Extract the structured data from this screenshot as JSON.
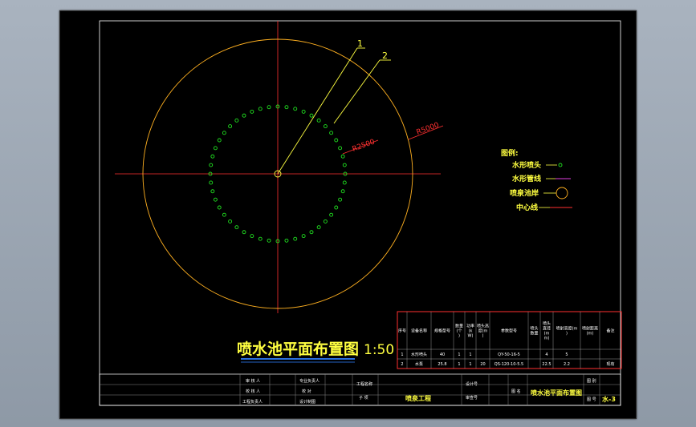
{
  "drawing": {
    "title": "喷水池平面布置图",
    "scale": "1:50",
    "colors": {
      "background": "#000000",
      "frame": "#ffffff",
      "outer_circle": "#ffb020",
      "center_line": "#ff3030",
      "nozzle_ring": "#20e020",
      "leader": "#ffff40",
      "dimension": "#ff3030",
      "table_border": "#ff3030",
      "title_text": "#ffff40"
    },
    "callouts": [
      "1",
      "2"
    ],
    "radius_labels": [
      "R2500",
      "R5000"
    ],
    "legend": {
      "heading": "图例:",
      "items": [
        {
          "label": "水形喷头",
          "symbol": "small-circle",
          "color": "#20e020"
        },
        {
          "label": "水形管线",
          "symbol": "line",
          "color": "#e040e0"
        },
        {
          "label": "喷泉池岸",
          "symbol": "circle",
          "color": "#ffb020"
        },
        {
          "label": "中心线",
          "symbol": "line",
          "color": "#ff3030"
        }
      ]
    },
    "equipment_table": {
      "headers": [
        "序号",
        "设备名称",
        "规格型号",
        "数量(个)",
        "功率(kW)",
        "喷头高度(m)",
        "参数型号",
        "喷头数量",
        "喷头直径(mm)",
        "喷射高度(m)",
        "喷射距离(m)",
        "备注"
      ],
      "rows": [
        [
          "1",
          "水形喷头",
          "40",
          "1",
          "1",
          "",
          "QY-50-16-5",
          "",
          "4",
          "5",
          "",
          ""
        ],
        [
          "2",
          "水泵",
          "25.8",
          "1",
          "1",
          "20",
          "QS-120-10-5.5",
          "",
          "22.5",
          "2.2",
          "",
          "现有"
        ]
      ]
    },
    "title_block": {
      "left_labels": [
        "审 核 人",
        "校 核 人",
        "工程负责人"
      ],
      "mid_labels": [
        "专业负责人",
        "校 对",
        "设计制图"
      ],
      "project_label": "工程名称",
      "project_value": "",
      "sub_label": "子 项",
      "sub_value": "喷泉工程",
      "design_no_label": "设计号",
      "review_no_label": "审查号",
      "figure_label": "图 名",
      "figure_value": "喷水池平面布置图",
      "sheet_label": "图 别",
      "sheet_no_label": "图 号",
      "sheet_no": "水-3"
    }
  }
}
